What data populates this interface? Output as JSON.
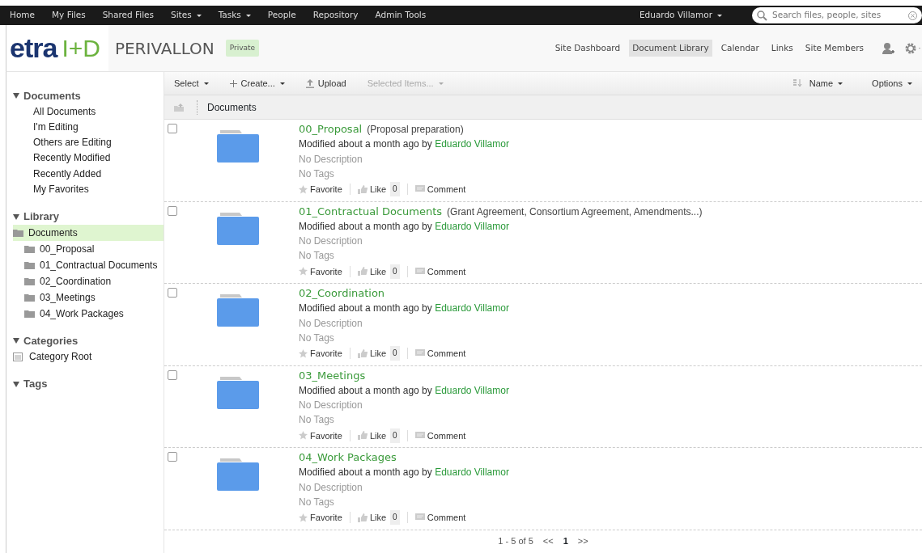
{
  "top_nav": {
    "items": [
      {
        "label": "Home",
        "dropdown": false
      },
      {
        "label": "My Files",
        "dropdown": false
      },
      {
        "label": "Shared Files",
        "dropdown": false
      },
      {
        "label": "Sites",
        "dropdown": true
      },
      {
        "label": "Tasks",
        "dropdown": true
      },
      {
        "label": "People",
        "dropdown": false
      },
      {
        "label": "Repository",
        "dropdown": false
      },
      {
        "label": "Admin Tools",
        "dropdown": false
      }
    ],
    "user": {
      "label": "Eduardo Villamor",
      "dropdown": true
    },
    "search": {
      "placeholder": "Search files, people, sites"
    }
  },
  "site": {
    "logo_main": "etra",
    "logo_accent": "I+D",
    "title": "PERIVALLON",
    "visibility": "Private",
    "nav": [
      {
        "label": "Site Dashboard",
        "selected": false
      },
      {
        "label": "Document Library",
        "selected": true
      },
      {
        "label": "Calendar",
        "selected": false
      },
      {
        "label": "Links",
        "selected": false
      },
      {
        "label": "Site Members",
        "selected": false
      }
    ]
  },
  "sidebar": {
    "sections": [
      {
        "title": "Documents",
        "expanded": true,
        "kind": "filters",
        "items": [
          {
            "label": "All Documents"
          },
          {
            "label": "I'm Editing"
          },
          {
            "label": "Others are Editing"
          },
          {
            "label": "Recently Modified"
          },
          {
            "label": "Recently Added"
          },
          {
            "label": "My Favorites"
          }
        ]
      },
      {
        "title": "Library",
        "expanded": true,
        "kind": "tree",
        "items": [
          {
            "label": "Documents",
            "selected": true,
            "children": [
              {
                "label": "00_Proposal",
                "selected": false
              },
              {
                "label": "01_Contractual Documents",
                "selected": false
              },
              {
                "label": "02_Coordination",
                "selected": false
              },
              {
                "label": "03_Meetings",
                "selected": false
              },
              {
                "label": "04_Work Packages",
                "selected": false
              }
            ]
          }
        ]
      },
      {
        "title": "Categories",
        "expanded": true,
        "kind": "categories",
        "items": [
          {
            "label": "Category Root"
          }
        ]
      },
      {
        "title": "Tags",
        "expanded": true
      }
    ]
  },
  "toolbar": {
    "left": [
      {
        "label": "Select",
        "kind": "menu",
        "disabled": false
      },
      {
        "label": "Create...",
        "kind": "create",
        "disabled": false
      },
      {
        "label": "Upload",
        "kind": "upload",
        "disabled": false
      },
      {
        "label": "Selected Items...",
        "kind": "menu",
        "disabled": true
      }
    ],
    "sort": {
      "label": "Name"
    },
    "options": {
      "label": "Options"
    }
  },
  "breadcrumb": {
    "label": "Documents"
  },
  "rows": [
    {
      "name": "00_Proposal",
      "title": "(Proposal preparation)",
      "modified": "Modified about a month ago by",
      "user": "Eduardo Villamor",
      "description": "No Description",
      "tags": "No Tags",
      "favorite": "Favorite",
      "like": "Like",
      "like_count": "0",
      "comment": "Comment",
      "checked": false
    },
    {
      "name": "01_Contractual Documents",
      "title": "(Grant Agreement, Consortium Agreement, Amendments...)",
      "modified": "Modified about a month ago by",
      "user": "Eduardo Villamor",
      "description": "No Description",
      "tags": "No Tags",
      "favorite": "Favorite",
      "like": "Like",
      "like_count": "0",
      "comment": "Comment",
      "checked": false
    },
    {
      "name": "02_Coordination",
      "modified": "Modified about a month ago by",
      "user": "Eduardo Villamor",
      "description": "No Description",
      "tags": "No Tags",
      "favorite": "Favorite",
      "like": "Like",
      "like_count": "0",
      "comment": "Comment",
      "checked": false
    },
    {
      "name": "03_Meetings",
      "modified": "Modified about a month ago by",
      "user": "Eduardo Villamor",
      "description": "No Description",
      "tags": "No Tags",
      "favorite": "Favorite",
      "like": "Like",
      "like_count": "0",
      "comment": "Comment",
      "checked": false
    },
    {
      "name": "04_Work Packages",
      "modified": "Modified about a month ago by",
      "user": "Eduardo Villamor",
      "description": "No Description",
      "tags": "No Tags",
      "favorite": "Favorite",
      "like": "Like",
      "like_count": "0",
      "comment": "Comment",
      "checked": false
    }
  ],
  "pagination": {
    "summary": "1 - 5 of 5",
    "prev": "<<",
    "pages": [
      {
        "label": "1",
        "selected": true
      }
    ],
    "next": ">>"
  }
}
